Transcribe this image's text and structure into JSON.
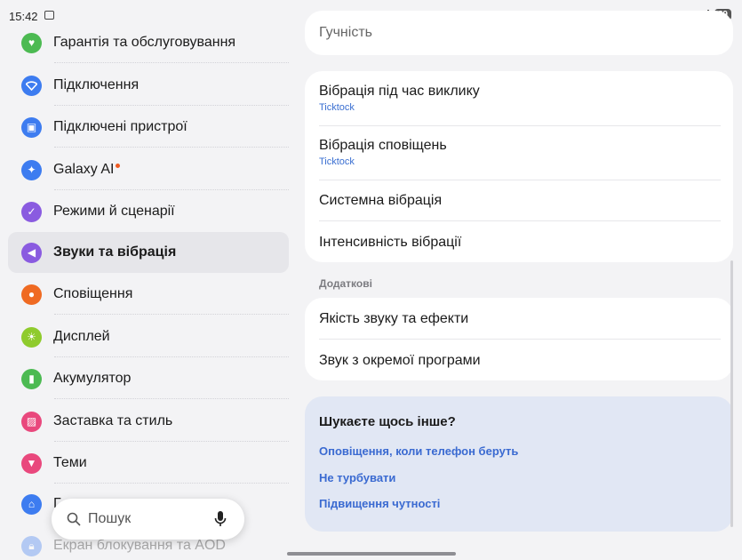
{
  "status": {
    "time": "15:42",
    "battery": "89"
  },
  "sidebar": {
    "items": [
      {
        "label": "Гарантія та обслуговування",
        "icon": "heart-shield-icon",
        "color": "#4cba52"
      },
      {
        "label": "Підключення",
        "icon": "wifi-icon",
        "color": "#3d7cf0"
      },
      {
        "label": "Підключені пристрої",
        "icon": "devices-icon",
        "color": "#3d7cf0"
      },
      {
        "label": "Galaxy AI",
        "icon": "sparkle-icon",
        "color": "#3d7cf0"
      },
      {
        "label": "Режими й сценарії",
        "icon": "check-circle-icon",
        "color": "#8a5be0"
      },
      {
        "label": "Звуки та вібрація",
        "icon": "speaker-icon",
        "color": "#8a5be0",
        "active": true
      },
      {
        "label": "Сповіщення",
        "icon": "bell-icon",
        "color": "#ef6a22"
      },
      {
        "label": "Дисплей",
        "icon": "sun-icon",
        "color": "#8fcb2d"
      },
      {
        "label": "Акумулятор",
        "icon": "battery-icon",
        "color": "#4cba52"
      },
      {
        "label": "Заставка та стиль",
        "icon": "image-icon",
        "color": "#e9487d"
      },
      {
        "label": "Теми",
        "icon": "brush-icon",
        "color": "#e9487d"
      },
      {
        "label": "Г",
        "icon": "home-icon",
        "color": "#3d7cf0"
      },
      {
        "label": "Екран блокування та AOD",
        "icon": "lock-icon",
        "color": "#3d7cf0"
      }
    ]
  },
  "search": {
    "placeholder": "Пошук"
  },
  "main": {
    "volume_label": "Гучність",
    "vibration": [
      {
        "title": "Вібрація під час виклику",
        "sub": "Ticktock"
      },
      {
        "title": "Вібрація сповіщень",
        "sub": "Ticktock"
      },
      {
        "title": "Системна вібрація"
      },
      {
        "title": "Інтенсивність вібрації"
      }
    ],
    "extra_header": "Додаткові",
    "extra": [
      {
        "title": "Якість звуку та ефекти"
      },
      {
        "title": "Звук з окремої програми"
      }
    ],
    "help": {
      "title": "Шукаєте щось інше?",
      "links": [
        "Оповіщення, коли телефон беруть",
        "Не турбувати",
        "Підвищення чутності"
      ]
    }
  }
}
